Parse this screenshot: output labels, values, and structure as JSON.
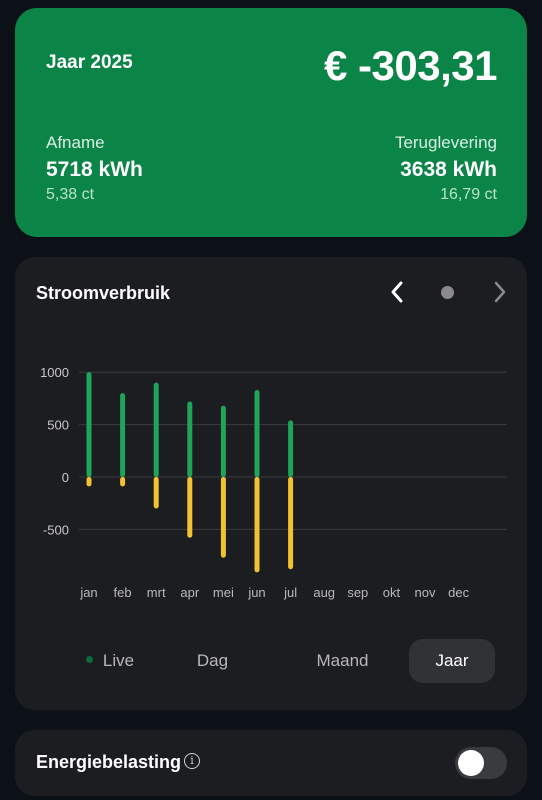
{
  "summary": {
    "year_label": "Jaar 2025",
    "total_cost": "€ -303,31",
    "afname": {
      "label": "Afname",
      "value": "5718 kWh",
      "price": "5,38 ct"
    },
    "teruglevering": {
      "label": "Teruglevering",
      "value": "3638 kWh",
      "price": "16,79 ct"
    }
  },
  "chart_card": {
    "title": "Stroomverbruik",
    "nav": {
      "prev_icon": "chevron-left-icon",
      "indicator_icon": "dot-icon",
      "next_icon": "chevron-right-icon"
    }
  },
  "chart_data": {
    "type": "bar",
    "categories": [
      "jan",
      "feb",
      "mrt",
      "apr",
      "mei",
      "jun",
      "jul",
      "aug",
      "sep",
      "okt",
      "nov",
      "dec"
    ],
    "series": [
      {
        "values": [
          1000,
          800,
          900,
          720,
          680,
          830,
          540,
          null,
          null,
          null,
          null,
          null
        ],
        "color": "#1fa55a"
      },
      {
        "values": [
          -90,
          -90,
          -300,
          -580,
          -770,
          -910,
          -880,
          null,
          null,
          null,
          null,
          null
        ],
        "color": "#f2c230"
      }
    ],
    "y_ticks": [
      "1000",
      "500",
      "0",
      "-500"
    ],
    "ylim": [
      -1000,
      1000
    ],
    "grid": true
  },
  "tabs": [
    {
      "label": "Live",
      "active": false
    },
    {
      "label": "Dag",
      "active": false
    },
    {
      "label": "Maand",
      "active": false
    },
    {
      "label": "Jaar",
      "active": true
    }
  ],
  "tax": {
    "label": "Energiebelasting",
    "info_icon": "info-icon",
    "toggle_on": false
  },
  "colors": {
    "card_green": "#0b8448",
    "usage": "#1fa55a",
    "return": "#f2c230",
    "background": "#0c1117",
    "panel": "#1c1d20"
  }
}
